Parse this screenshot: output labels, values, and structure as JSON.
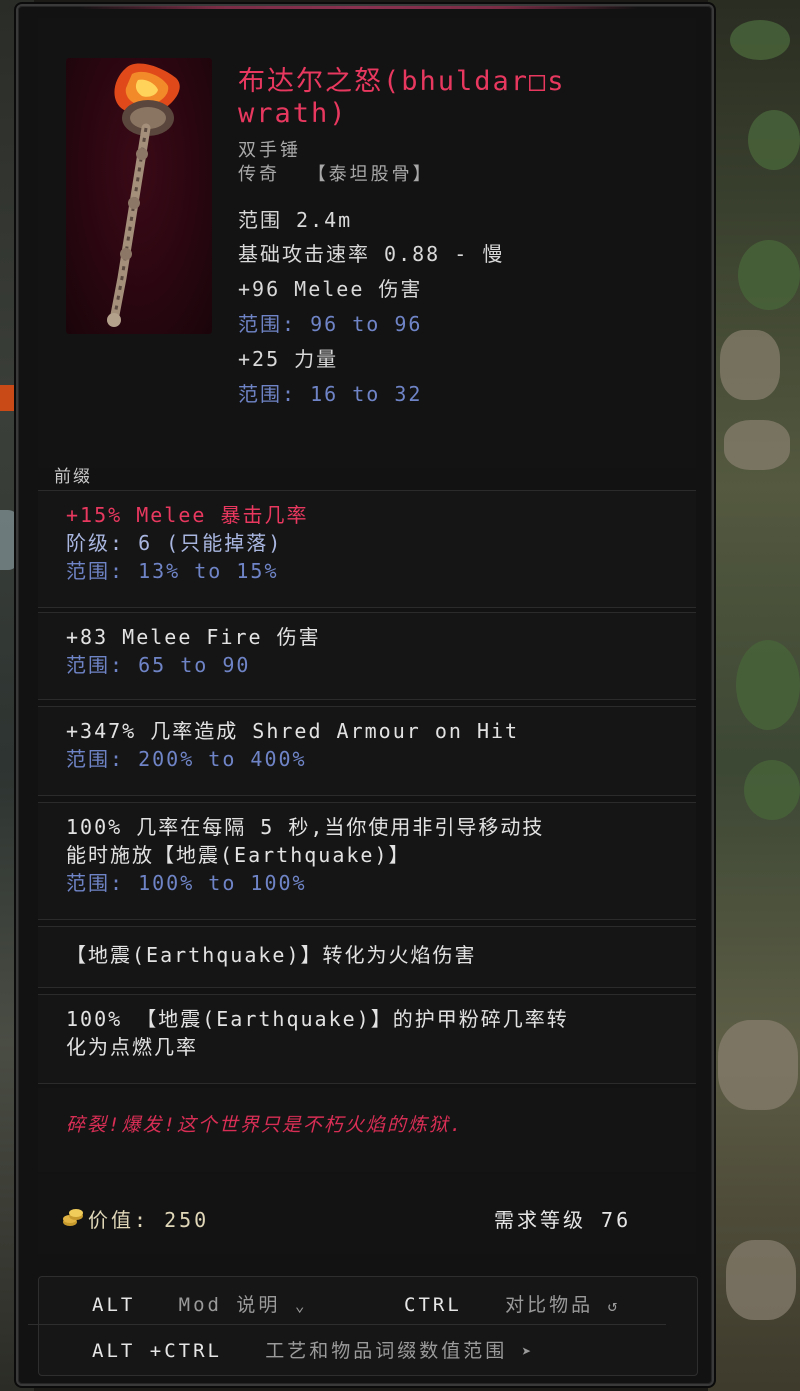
{
  "item": {
    "name": "布达尔之怒(bhuldar□s wrath)",
    "type": "双手锤",
    "rarity": "传奇",
    "base": "【泰坦股骨】",
    "range_label": "范围 2.4m",
    "attack_speed": "基础攻击速率 0.88 - 慢",
    "implicits": [
      {
        "text": "+96 Melee 伤害",
        "range": "范围: 96 to 96"
      },
      {
        "text": "+25 力量",
        "range": "范围: 16 to 32"
      }
    ]
  },
  "section_label": "前缀",
  "affixes": [
    {
      "text": "+15% Melee 暴击几率",
      "tier": "阶级: 6 (只能掉落)",
      "range": "范围: 13% to 15%"
    },
    {
      "text": "+83 Melee Fire 伤害",
      "range": "范围: 65 to 90"
    },
    {
      "text": "+347% 几率造成 Shred Armour on Hit",
      "range": "范围: 200% to 400%"
    },
    {
      "text_line1": "100% 几率在每隔 5 秒,当你使用非引导移动技",
      "text_line2": "能时施放【地震(Earthquake)】",
      "range": "范围: 100% to 100%"
    },
    {
      "text": "【地震(Earthquake)】转化为火焰伤害"
    },
    {
      "text_line1": "100% 【地震(Earthquake)】的护甲粉碎几率转",
      "text_line2": "化为点燃几率"
    }
  ],
  "lore": "碎裂!爆发!这个世界只是不朽火焰的炼狱.",
  "footer": {
    "value": "价值: 250",
    "level_req": "需求等级 76"
  },
  "hints": {
    "alt_key": "ALT",
    "alt_desc": "Mod 说明",
    "ctrl_key": "CTRL",
    "ctrl_desc": "对比物品",
    "altctrl_key": "ALT +CTRL",
    "altctrl_desc": "工艺和物品词缀数值范围"
  },
  "colors": {
    "unique_name": "#e8385f",
    "range": "#6f84c6",
    "lore": "#d82e55"
  }
}
